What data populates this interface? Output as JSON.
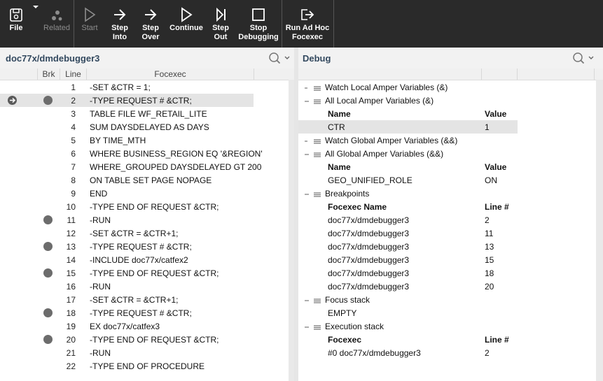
{
  "toolbar": {
    "file": "File",
    "related": "Related",
    "start": "Start",
    "step_into": "Step\nInto",
    "step_over": "Step\nOver",
    "continue": "Continue",
    "step_out": "Step\nOut",
    "stop_debugging": "Stop\nDebugging",
    "run_adhoc": "Run Ad Hoc\nFocexec"
  },
  "left": {
    "title": "doc77x/dmdebugger3",
    "columns": {
      "brk": "Brk",
      "line": "Line",
      "focexec": "Focexec"
    },
    "lines": [
      {
        "n": "1",
        "code": "-SET &CTR = 1;",
        "bp": false
      },
      {
        "n": "2",
        "code": "-TYPE REQUEST # &CTR;",
        "bp": true,
        "current": true
      },
      {
        "n": "3",
        "code": "TABLE FILE WF_RETAIL_LITE",
        "bp": false
      },
      {
        "n": "4",
        "code": "SUM DAYSDELAYED AS DAYS",
        "bp": false
      },
      {
        "n": "5",
        "code": "BY TIME_MTH",
        "bp": false
      },
      {
        "n": "6",
        "code": "WHERE BUSINESS_REGION EQ '&REGION'",
        "bp": false
      },
      {
        "n": "7",
        "code": "WHERE_GROUPED DAYSDELAYED GT 200",
        "bp": false
      },
      {
        "n": "8",
        "code": "ON TABLE SET PAGE NOPAGE",
        "bp": false
      },
      {
        "n": "9",
        "code": "END",
        "bp": false
      },
      {
        "n": "10",
        "code": "-TYPE END OF REQUEST &CTR;",
        "bp": false
      },
      {
        "n": "11",
        "code": "-RUN",
        "bp": true
      },
      {
        "n": "12",
        "code": "-SET &CTR = &CTR+1;",
        "bp": false
      },
      {
        "n": "13",
        "code": "-TYPE REQUEST # &CTR;",
        "bp": true
      },
      {
        "n": "14",
        "code": "-INCLUDE doc77x/catfex2",
        "bp": false
      },
      {
        "n": "15",
        "code": "-TYPE END OF REQUEST &CTR;",
        "bp": true
      },
      {
        "n": "16",
        "code": "-RUN",
        "bp": false
      },
      {
        "n": "17",
        "code": "-SET &CTR = &CTR+1;",
        "bp": false
      },
      {
        "n": "18",
        "code": "-TYPE REQUEST # &CTR;",
        "bp": true
      },
      {
        "n": "19",
        "code": "EX doc77x/catfex3",
        "bp": false
      },
      {
        "n": "20",
        "code": "-TYPE END OF REQUEST &CTR;",
        "bp": true
      },
      {
        "n": "21",
        "code": "-RUN",
        "bp": false
      },
      {
        "n": "22",
        "code": "-TYPE END OF PROCEDURE",
        "bp": false
      }
    ]
  },
  "right": {
    "title": "Debug",
    "tree": [
      {
        "kind": "group",
        "icon": "collapsed",
        "text": "Watch Local Amper Variables (&)"
      },
      {
        "kind": "group",
        "icon": "expanded",
        "text": "All Local Amper Variables (&)"
      },
      {
        "kind": "head",
        "c1": "Name",
        "c2": "Value"
      },
      {
        "kind": "item",
        "c1": "CTR",
        "c2": "1",
        "sel": true
      },
      {
        "kind": "group",
        "icon": "collapsed",
        "text": "Watch Global Amper Variables (&&)"
      },
      {
        "kind": "group",
        "icon": "expanded",
        "text": "All Global Amper Variables (&&)"
      },
      {
        "kind": "head",
        "c1": "Name",
        "c2": "Value"
      },
      {
        "kind": "item",
        "c1": "GEO_UNIFIED_ROLE",
        "c2": "ON"
      },
      {
        "kind": "group",
        "icon": "expanded",
        "text": "Breakpoints"
      },
      {
        "kind": "head",
        "c1": "Focexec Name",
        "c2": "Line #"
      },
      {
        "kind": "item",
        "c1": "doc77x/dmdebugger3",
        "c2": "2"
      },
      {
        "kind": "item",
        "c1": "doc77x/dmdebugger3",
        "c2": "11"
      },
      {
        "kind": "item",
        "c1": "doc77x/dmdebugger3",
        "c2": "13"
      },
      {
        "kind": "item",
        "c1": "doc77x/dmdebugger3",
        "c2": "15"
      },
      {
        "kind": "item",
        "c1": "doc77x/dmdebugger3",
        "c2": "18"
      },
      {
        "kind": "item",
        "c1": "doc77x/dmdebugger3",
        "c2": "20"
      },
      {
        "kind": "group",
        "icon": "expanded",
        "text": "Focus stack"
      },
      {
        "kind": "item",
        "c1": "EMPTY",
        "c2": ""
      },
      {
        "kind": "group",
        "icon": "expanded",
        "text": "Execution stack"
      },
      {
        "kind": "head",
        "c1": "Focexec",
        "c2": "Line #"
      },
      {
        "kind": "item",
        "c1": "#0 doc77x/dmdebugger3",
        "c2": "2"
      }
    ]
  }
}
